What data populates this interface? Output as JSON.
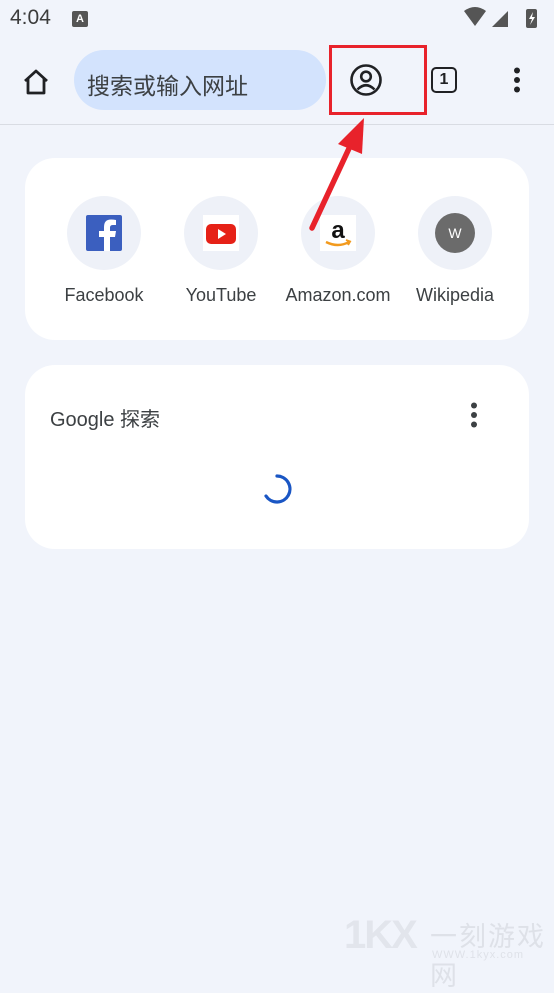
{
  "status_bar": {
    "time": "4:04",
    "notification_icon": "A"
  },
  "toolbar": {
    "home_icon": "home-icon",
    "omnibox_placeholder": "搜索或输入网址",
    "account_icon": "account-circle-icon",
    "tab_count": "1",
    "menu_icon": "more-vert-icon"
  },
  "shortcuts": [
    {
      "label": "Facebook",
      "icon": "facebook-icon"
    },
    {
      "label": "YouTube",
      "icon": "youtube-icon"
    },
    {
      "label": "Amazon.com",
      "icon": "amazon-icon"
    },
    {
      "label": "Wikipedia",
      "icon": "wikipedia-icon",
      "letter": "W"
    }
  ],
  "google_card": {
    "title": "Google 探索",
    "more_icon": "more-vert-icon"
  },
  "watermark": {
    "logo": "1KX",
    "name": "一刻游戏网",
    "url": "WWW.1kyx.com"
  },
  "colors": {
    "background": "#f1f4fb",
    "omnibox": "#d3e3fd",
    "highlight": "#e8222b",
    "spinner": "#1a56c4"
  }
}
